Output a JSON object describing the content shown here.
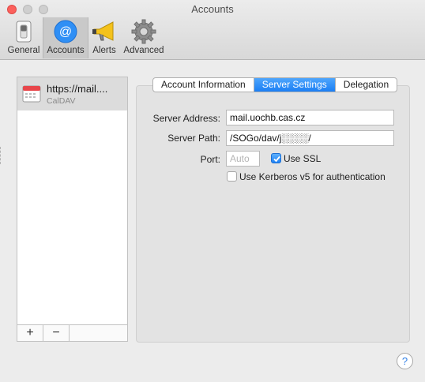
{
  "window": {
    "title": "Accounts"
  },
  "toolbar": {
    "items": [
      {
        "label": "General",
        "icon": "general-switch-icon",
        "selected": false
      },
      {
        "label": "Accounts",
        "icon": "at-sign-icon",
        "selected": true
      },
      {
        "label": "Alerts",
        "icon": "megaphone-icon",
        "selected": false
      },
      {
        "label": "Advanced",
        "icon": "gear-icon",
        "selected": false
      }
    ]
  },
  "accounts": [
    {
      "name": "https://mail....",
      "type": "CalDAV",
      "icon": "calendar-icon"
    }
  ],
  "list_controls": {
    "add": "+",
    "remove": "−"
  },
  "tabs": [
    {
      "label": "Account Information",
      "active": false
    },
    {
      "label": "Server Settings",
      "active": true
    },
    {
      "label": "Delegation",
      "active": false
    }
  ],
  "form": {
    "server_address_label": "Server Address:",
    "server_address_value": "mail.uochb.cas.cz",
    "server_path_label": "Server Path:",
    "server_path_value": "/SOGo/dav/j░░░░/",
    "port_label": "Port:",
    "port_placeholder": "Auto",
    "use_ssl_label": "Use SSL",
    "use_ssl_checked": true,
    "kerberos_label": "Use Kerberos v5 for authentication",
    "kerberos_checked": false
  },
  "help": {
    "label": "?"
  },
  "colors": {
    "accent": "#1b7ff4",
    "close": "#fc605c"
  }
}
